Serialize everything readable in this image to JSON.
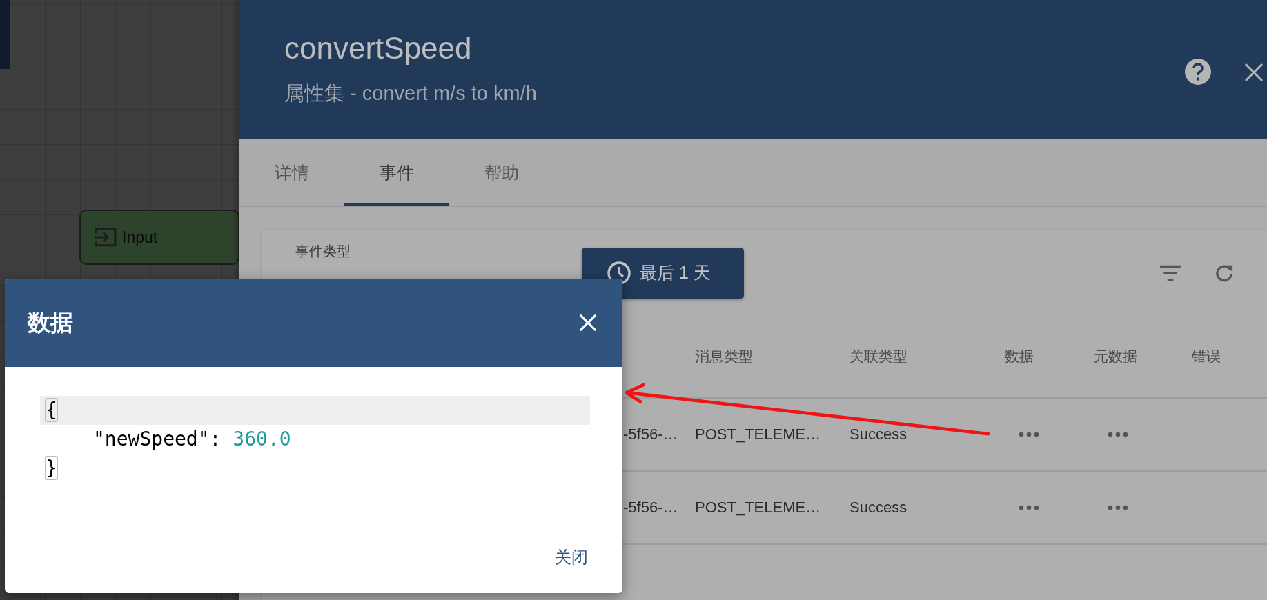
{
  "canvas": {
    "nodes": [
      {
        "label": "Input"
      }
    ]
  },
  "panel": {
    "title": "convertSpeed",
    "subtitle": "属性集 - convert m/s to km/h",
    "tabs": [
      {
        "label": "详情",
        "selected": false
      },
      {
        "label": "事件",
        "selected": true
      },
      {
        "label": "帮助",
        "selected": false
      }
    ],
    "event_type": {
      "label": "事件类型"
    },
    "time_button": "最后 1 天",
    "table": {
      "columns": [
        "消息类型",
        "关联类型",
        "数据",
        "元数据",
        "错误"
      ],
      "rows": [
        {
          "column_1": "-5f56-…",
          "message_type": "POST_TELEME…",
          "relation_type": "Success"
        },
        {
          "column_1": "-5f56-…",
          "message_type": "POST_TELEME…",
          "relation_type": "Success"
        }
      ]
    }
  },
  "dialog": {
    "title": "数据",
    "code": [
      {
        "kind": "brace",
        "text": "{",
        "active": true
      },
      {
        "kind": "pair",
        "key": "\"newSpeed\":",
        "value": "360.0"
      },
      {
        "kind": "brace",
        "text": "}"
      }
    ],
    "close_button": "关闭"
  }
}
